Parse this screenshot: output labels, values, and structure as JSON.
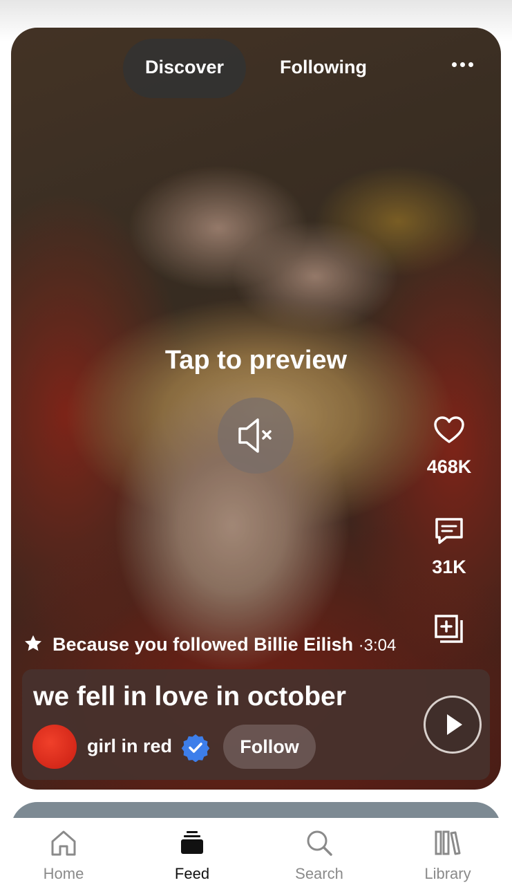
{
  "header": {
    "tabs": [
      {
        "label": "Discover",
        "active": true
      },
      {
        "label": "Following",
        "active": false
      }
    ],
    "more_icon": "more-horizontal-icon"
  },
  "preview": {
    "tap_label": "Tap to preview",
    "mute_icon": "speaker-muted-icon"
  },
  "actions": {
    "likes": "468K",
    "comments": "31K",
    "like_icon": "heart-icon",
    "comment_icon": "comment-icon",
    "add_icon": "add-to-playlist-icon"
  },
  "recommendation": {
    "reason": "Because you followed Billie Eilish",
    "separator": "·",
    "duration": "3:04",
    "icon": "star-icon"
  },
  "track": {
    "title": "we fell in love in october",
    "artist": "girl in red",
    "verified": true,
    "follow_label": "Follow",
    "avatar_color": "#d8261a"
  },
  "nav": {
    "items": [
      {
        "label": "Home",
        "icon": "home-icon",
        "active": false
      },
      {
        "label": "Feed",
        "icon": "feed-icon",
        "active": true
      },
      {
        "label": "Search",
        "icon": "search-icon",
        "active": false
      },
      {
        "label": "Library",
        "icon": "library-icon",
        "active": false
      }
    ]
  },
  "colors": {
    "verified_badge": "#3d7eea",
    "active_nav": "#111111",
    "inactive_nav": "#8a8a8a"
  }
}
